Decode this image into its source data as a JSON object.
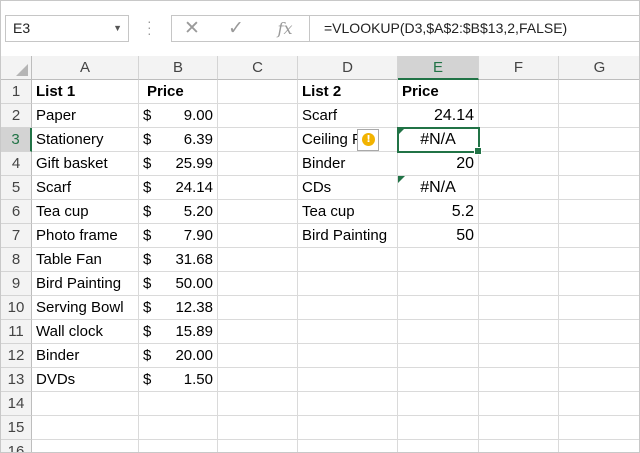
{
  "name_box": {
    "value": "E3",
    "dropdown_icon": "chevron-down-icon"
  },
  "formula_bar": {
    "cancel_icon": "✕",
    "enter_icon": "✓",
    "fx_label": "fx",
    "formula": "=VLOOKUP(D3,$A$2:$B$13,2,FALSE)"
  },
  "columns": [
    "A",
    "B",
    "C",
    "D",
    "E",
    "F",
    "G"
  ],
  "rows": [
    "1",
    "2",
    "3",
    "4",
    "5",
    "6",
    "7",
    "8",
    "9",
    "10",
    "11",
    "12",
    "13",
    "14",
    "15",
    "16"
  ],
  "selected": {
    "column": "E",
    "row": "3"
  },
  "list1": {
    "header_name": "List 1",
    "header_price": "Price",
    "items": [
      {
        "name": "Paper",
        "currency": "$",
        "price": "9.00"
      },
      {
        "name": "Stationery",
        "currency": "$",
        "price": "6.39"
      },
      {
        "name": "Gift basket",
        "currency": "$",
        "price": "25.99"
      },
      {
        "name": "Scarf",
        "currency": "$",
        "price": "24.14"
      },
      {
        "name": "Tea cup",
        "currency": "$",
        "price": "5.20"
      },
      {
        "name": "Photo frame",
        "currency": "$",
        "price": "7.90"
      },
      {
        "name": "Table Fan",
        "currency": "$",
        "price": "31.68"
      },
      {
        "name": "Bird Painting",
        "currency": "$",
        "price": "50.00"
      },
      {
        "name": "Serving Bowl",
        "currency": "$",
        "price": "12.38"
      },
      {
        "name": "Wall clock",
        "currency": "$",
        "price": "15.89"
      },
      {
        "name": "Binder",
        "currency": "$",
        "price": "20.00"
      },
      {
        "name": "DVDs",
        "currency": "$",
        "price": "1.50"
      }
    ]
  },
  "list2": {
    "header_name": "List 2",
    "header_price": "Price",
    "items": [
      {
        "name": "Scarf",
        "price": "24.14"
      },
      {
        "name": "Ceiling Fan",
        "price": "#N/A"
      },
      {
        "name": "Binder",
        "price": "20"
      },
      {
        "name": "CDs",
        "price": "#N/A"
      },
      {
        "name": "Tea cup",
        "price": "5.2"
      },
      {
        "name": "Bird Painting",
        "price": "50"
      }
    ]
  },
  "error_indicator": {
    "icon": "warning-icon",
    "glyph": "!"
  },
  "colors": {
    "accent": "#217346",
    "warning": "#f2b300"
  }
}
